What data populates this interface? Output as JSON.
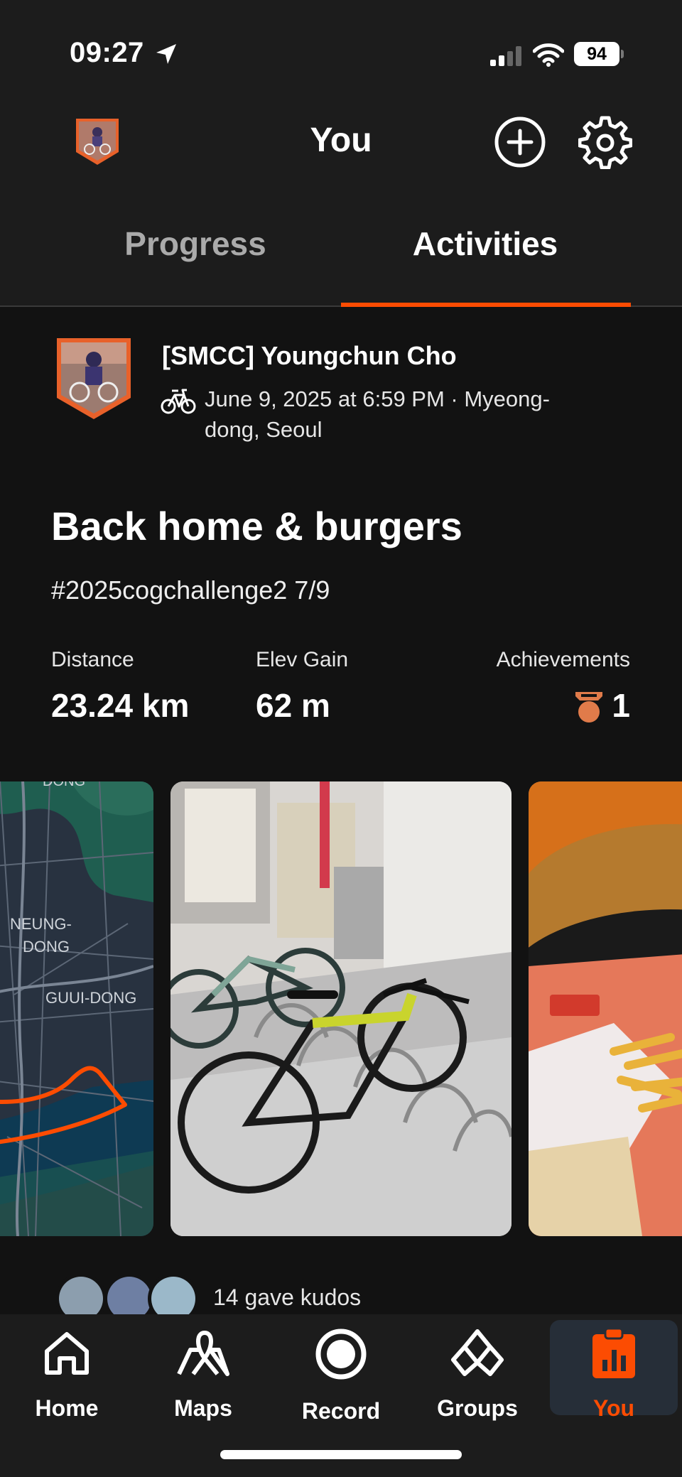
{
  "status_bar": {
    "time": "09:27",
    "battery": "94"
  },
  "header": {
    "title": "You"
  },
  "tabs": [
    {
      "label": "Progress",
      "active": false
    },
    {
      "label": "Activities",
      "active": true
    }
  ],
  "activity": {
    "athlete": "[SMCC] Youngchun Cho",
    "meta": "June 9, 2025 at 6:59 PM · Myeong-dong, Seoul",
    "title": "Back home & burgers",
    "description": "#2025cogchallenge2 7/9",
    "stats": [
      {
        "label": "Distance",
        "value": "23.24 km"
      },
      {
        "label": "Elev Gain",
        "value": "62 m"
      },
      {
        "label": "Achievements",
        "value": "1"
      }
    ],
    "map_labels": [
      "DONG",
      "NEUNG-",
      "DONG",
      "GUUI-DONG"
    ],
    "kudos": "14 gave kudos"
  },
  "nav": [
    {
      "label": "Home",
      "icon": "home-icon"
    },
    {
      "label": "Maps",
      "icon": "maps-icon"
    },
    {
      "label": "Record",
      "icon": "record-icon"
    },
    {
      "label": "Groups",
      "icon": "groups-icon"
    },
    {
      "label": "You",
      "icon": "you-icon",
      "active": true
    }
  ],
  "colors": {
    "accent": "#fc4c02",
    "background": "#121212",
    "header": "#1c1c1c"
  }
}
